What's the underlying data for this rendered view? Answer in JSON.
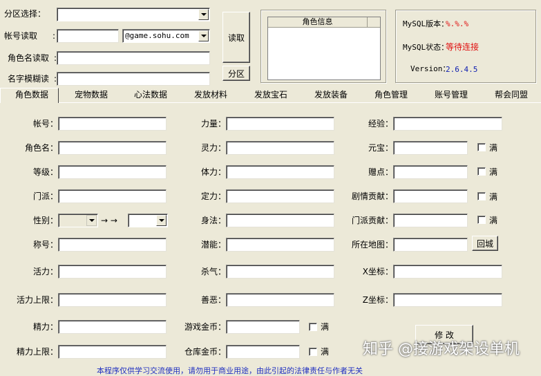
{
  "top": {
    "region_label": "分区选择：",
    "account_label": "帐号读取",
    "domain_select": "@game.sohu.com",
    "role_read_label": "角色名读取",
    "fuzzy_read_label": "名字模糊读",
    "read_button": "读取",
    "region_button": "分区",
    "role_info_header": "角色信息"
  },
  "mysql": {
    "version_label": "MySQL版本：",
    "version_value": "%.%.%",
    "status_label": "MySQL状态：",
    "status_value": "等待连接",
    "app_version_label": "Version：",
    "app_version_value": "2.6.4.5"
  },
  "tabs": [
    "角色数据",
    "宠物数据",
    "心法数据",
    "发放材料",
    "发放宝石",
    "发放装备",
    "角色管理",
    "账号管理",
    "帮会同盟"
  ],
  "left_fields": [
    "帐号：",
    "角色名：",
    "等级：",
    "门派：",
    "性别：",
    "称号：",
    "活力：",
    "活力上限：",
    "精力：",
    "精力上限："
  ],
  "gender_arrow": "→ →",
  "mid_fields": [
    "力量：",
    "灵力：",
    "体力：",
    "定力：",
    "身法：",
    "潜能：",
    "杀气：",
    "善恶：",
    "游戏金币：",
    "仓库金币："
  ],
  "right_fields": [
    "经验：",
    "元宝：",
    "赠点：",
    "剧情贡献：",
    "门派贡献：",
    "所在地图：",
    "X坐标：",
    "Z坐标："
  ],
  "full_label": "满",
  "return_city_button": "回城",
  "modify_button": "修  改",
  "watermark": "知乎 @接游戏架设单机",
  "footer_text": "本程序仅供学习交流使用，请勿用于商业用途，由此引起的法律责任与作者无关"
}
